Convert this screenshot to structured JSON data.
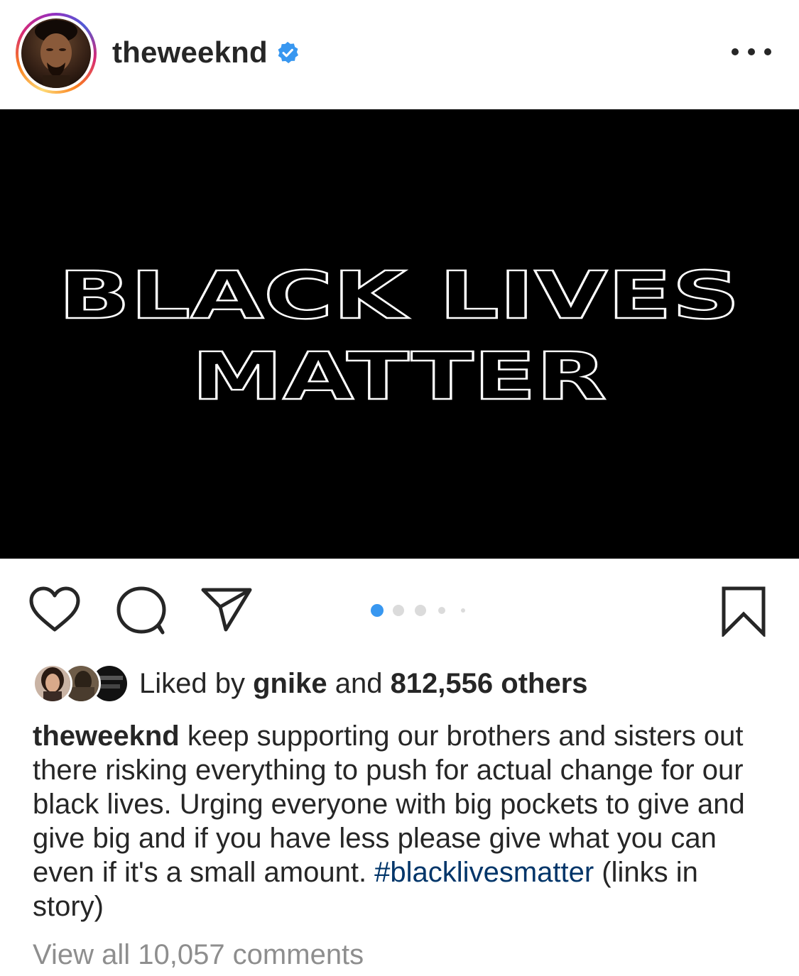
{
  "header": {
    "username": "theweeknd",
    "verified": true,
    "verified_icon": "verified-badge-icon",
    "more_icon": "more-options-icon"
  },
  "media": {
    "line1": "BLACK LIVES",
    "line2": "MATTER",
    "background_color": "#000000",
    "text_color": "#ffffff"
  },
  "actions": {
    "like_icon": "heart-icon",
    "comment_icon": "comment-icon",
    "share_icon": "send-icon",
    "save_icon": "bookmark-icon",
    "carousel": {
      "total": 5,
      "active_index": 0,
      "active_color": "#3897f0",
      "inactive_color": "#dbdbdb"
    }
  },
  "likes": {
    "prefix": "Liked by ",
    "liker": "gnike",
    "middle": " and ",
    "count": "812,556 others"
  },
  "caption": {
    "username": "theweeknd",
    "text": " keep supporting our brothers and sisters out there risking everything to push for actual change for our black lives. Urging everyone with big pockets to give and give big and if you have less please give what you can even if it's a small amount. ",
    "hashtag": "#blacklivesmatter",
    "suffix": " (links in story)"
  },
  "comments": {
    "label": "View all 10,057 comments"
  },
  "colors": {
    "text": "#262626",
    "muted": "#8e8e8e",
    "link": "#003569",
    "verified": "#3897f0"
  }
}
